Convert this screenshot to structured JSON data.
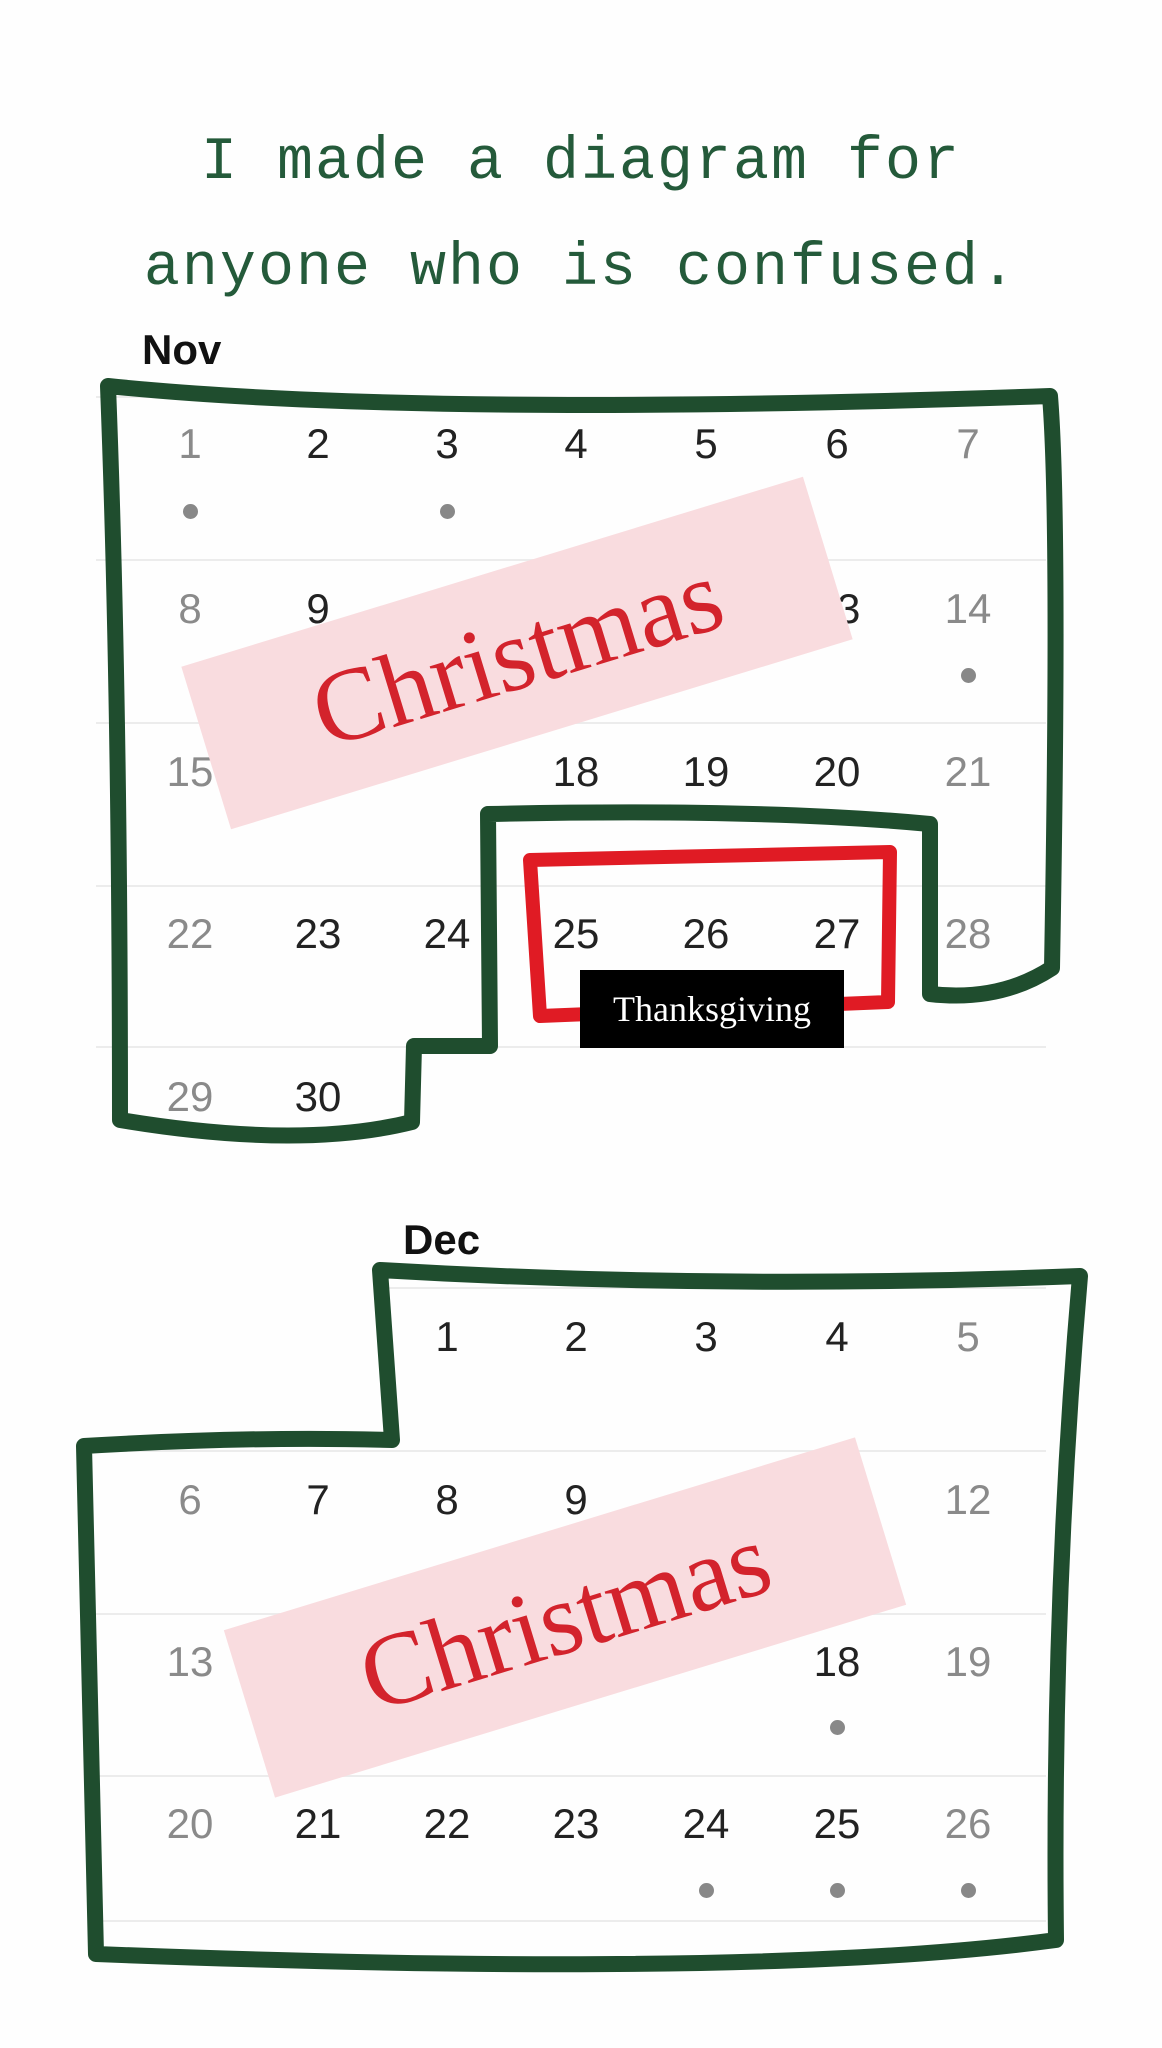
{
  "headline": {
    "line1": "I made a diagram for",
    "line2": "anyone who is confused."
  },
  "colors": {
    "outline": "#1f4d2e",
    "highlight": "#e01b24",
    "banner_bg": "#f9dcdf",
    "banner_text": "#d3232c",
    "title_text": "#245a3a"
  },
  "nov": {
    "label": "Nov",
    "days": [
      "1",
      "2",
      "3",
      "4",
      "5",
      "6",
      "7",
      "8",
      "9",
      "13",
      "14",
      "15",
      "18",
      "19",
      "20",
      "21",
      "22",
      "23",
      "24",
      "25",
      "26",
      "27",
      "28",
      "29",
      "30"
    ],
    "dotted_days": [
      "1",
      "3",
      "14"
    ]
  },
  "dec": {
    "label": "Dec",
    "days": [
      "1",
      "2",
      "3",
      "4",
      "5",
      "6",
      "7",
      "8",
      "9",
      "12",
      "13",
      "18",
      "19",
      "20",
      "21",
      "22",
      "23",
      "24",
      "25",
      "26"
    ],
    "dotted_days": [
      "18",
      "24",
      "25",
      "26"
    ]
  },
  "banner_top": {
    "text": "Christmas"
  },
  "banner_bottom": {
    "text": "Christmas"
  },
  "thanksgiving": {
    "text": "Thanksgiving"
  }
}
